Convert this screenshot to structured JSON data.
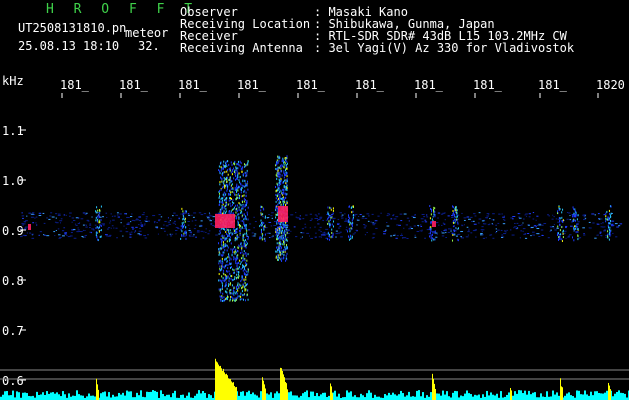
{
  "header": {
    "app_name": "H R O F F T",
    "filename": "UT2508131810.pn",
    "mode": "meteor",
    "datetime": "25.08.13 18:10",
    "count": "32.",
    "observer_label": "Observer",
    "observer_value": ": Masaki Kano",
    "location_label": "Receiving Location",
    "location_value": ": Shibukawa, Gunma, Japan",
    "receiver_label": "Receiver",
    "receiver_value": ": RTL-SDR SDR# 43dB L15 103.2MHz CW",
    "antenna_label": "Receiving Antenna",
    "antenna_value": ": 3el Yagi(V) Az 330 for Vladivostok"
  },
  "yaxis": {
    "unit": "kHz",
    "labels": [
      "1.1",
      "1.0",
      "0.9",
      "0.8",
      "0.7",
      "0.6"
    ]
  },
  "time_ticks": [
    "181_",
    "181_",
    "181_",
    "181_",
    "181_",
    "181_",
    "181_",
    "181_",
    "181_",
    "1820"
  ],
  "colors": {
    "text": "#ffffff",
    "title": "#3fd24a",
    "signal_yellow": "#ffff00",
    "noise_cyan": "#00ffff",
    "echo_red": "#ff2060",
    "echo_blue": "#1e3cff"
  }
}
